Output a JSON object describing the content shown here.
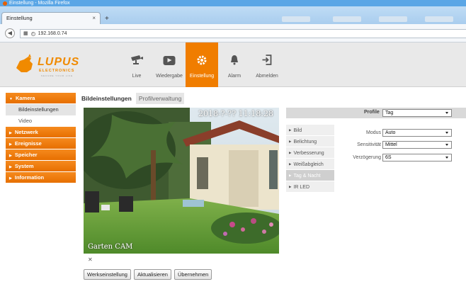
{
  "browser": {
    "window_title": "Einstellung - Mozilla Firefox",
    "tab_title": "Einstellung",
    "tab_close": "×",
    "new_tab": "+",
    "url": "192.168.0.74"
  },
  "logo": {
    "brand": "LUPUS",
    "sub": "ELECTRONICS",
    "tagline": "SECURE YOUR LIFE"
  },
  "nav": [
    {
      "label": "Live",
      "icon": "camera-icon"
    },
    {
      "label": "Wiedergabe",
      "icon": "play-icon"
    },
    {
      "label": "Einstellung",
      "icon": "gear-icon",
      "active": true
    },
    {
      "label": "Alarm",
      "icon": "bell-icon"
    },
    {
      "label": "Abmelden",
      "icon": "logout-icon"
    }
  ],
  "sidebar": {
    "kamera": "Kamera",
    "kamera_sub": [
      "Bildeinstellungen",
      "Video"
    ],
    "others": [
      "Netzwerk",
      "Ereignisse",
      "Speicher",
      "System",
      "Information"
    ]
  },
  "subtabs": [
    "Bildeinstellungen",
    "Profilverwaltung"
  ],
  "camera": {
    "timestamp": "2018-?-?? 11:18:28",
    "name": "Garten CAM"
  },
  "buttons": {
    "factory": "Werkseinstellung",
    "refresh": "Aktualisieren",
    "apply": "Übernehmen"
  },
  "settings": {
    "profile_label": "Profile",
    "profile_value": "Tag",
    "categories": [
      "Bild",
      "Belichtung",
      "Verbesserung",
      "Weißabgleich",
      "Tag & Nacht",
      "IR LED"
    ],
    "active_category": "Tag & Nacht",
    "fields": [
      {
        "label": "Modus",
        "value": "Auto"
      },
      {
        "label": "Sensitivität",
        "value": "Mittel"
      },
      {
        "label": "Verzögerung",
        "value": "6S"
      }
    ]
  },
  "colors": {
    "accent": "#f07d00",
    "header_bg": "#e9e9e9"
  }
}
